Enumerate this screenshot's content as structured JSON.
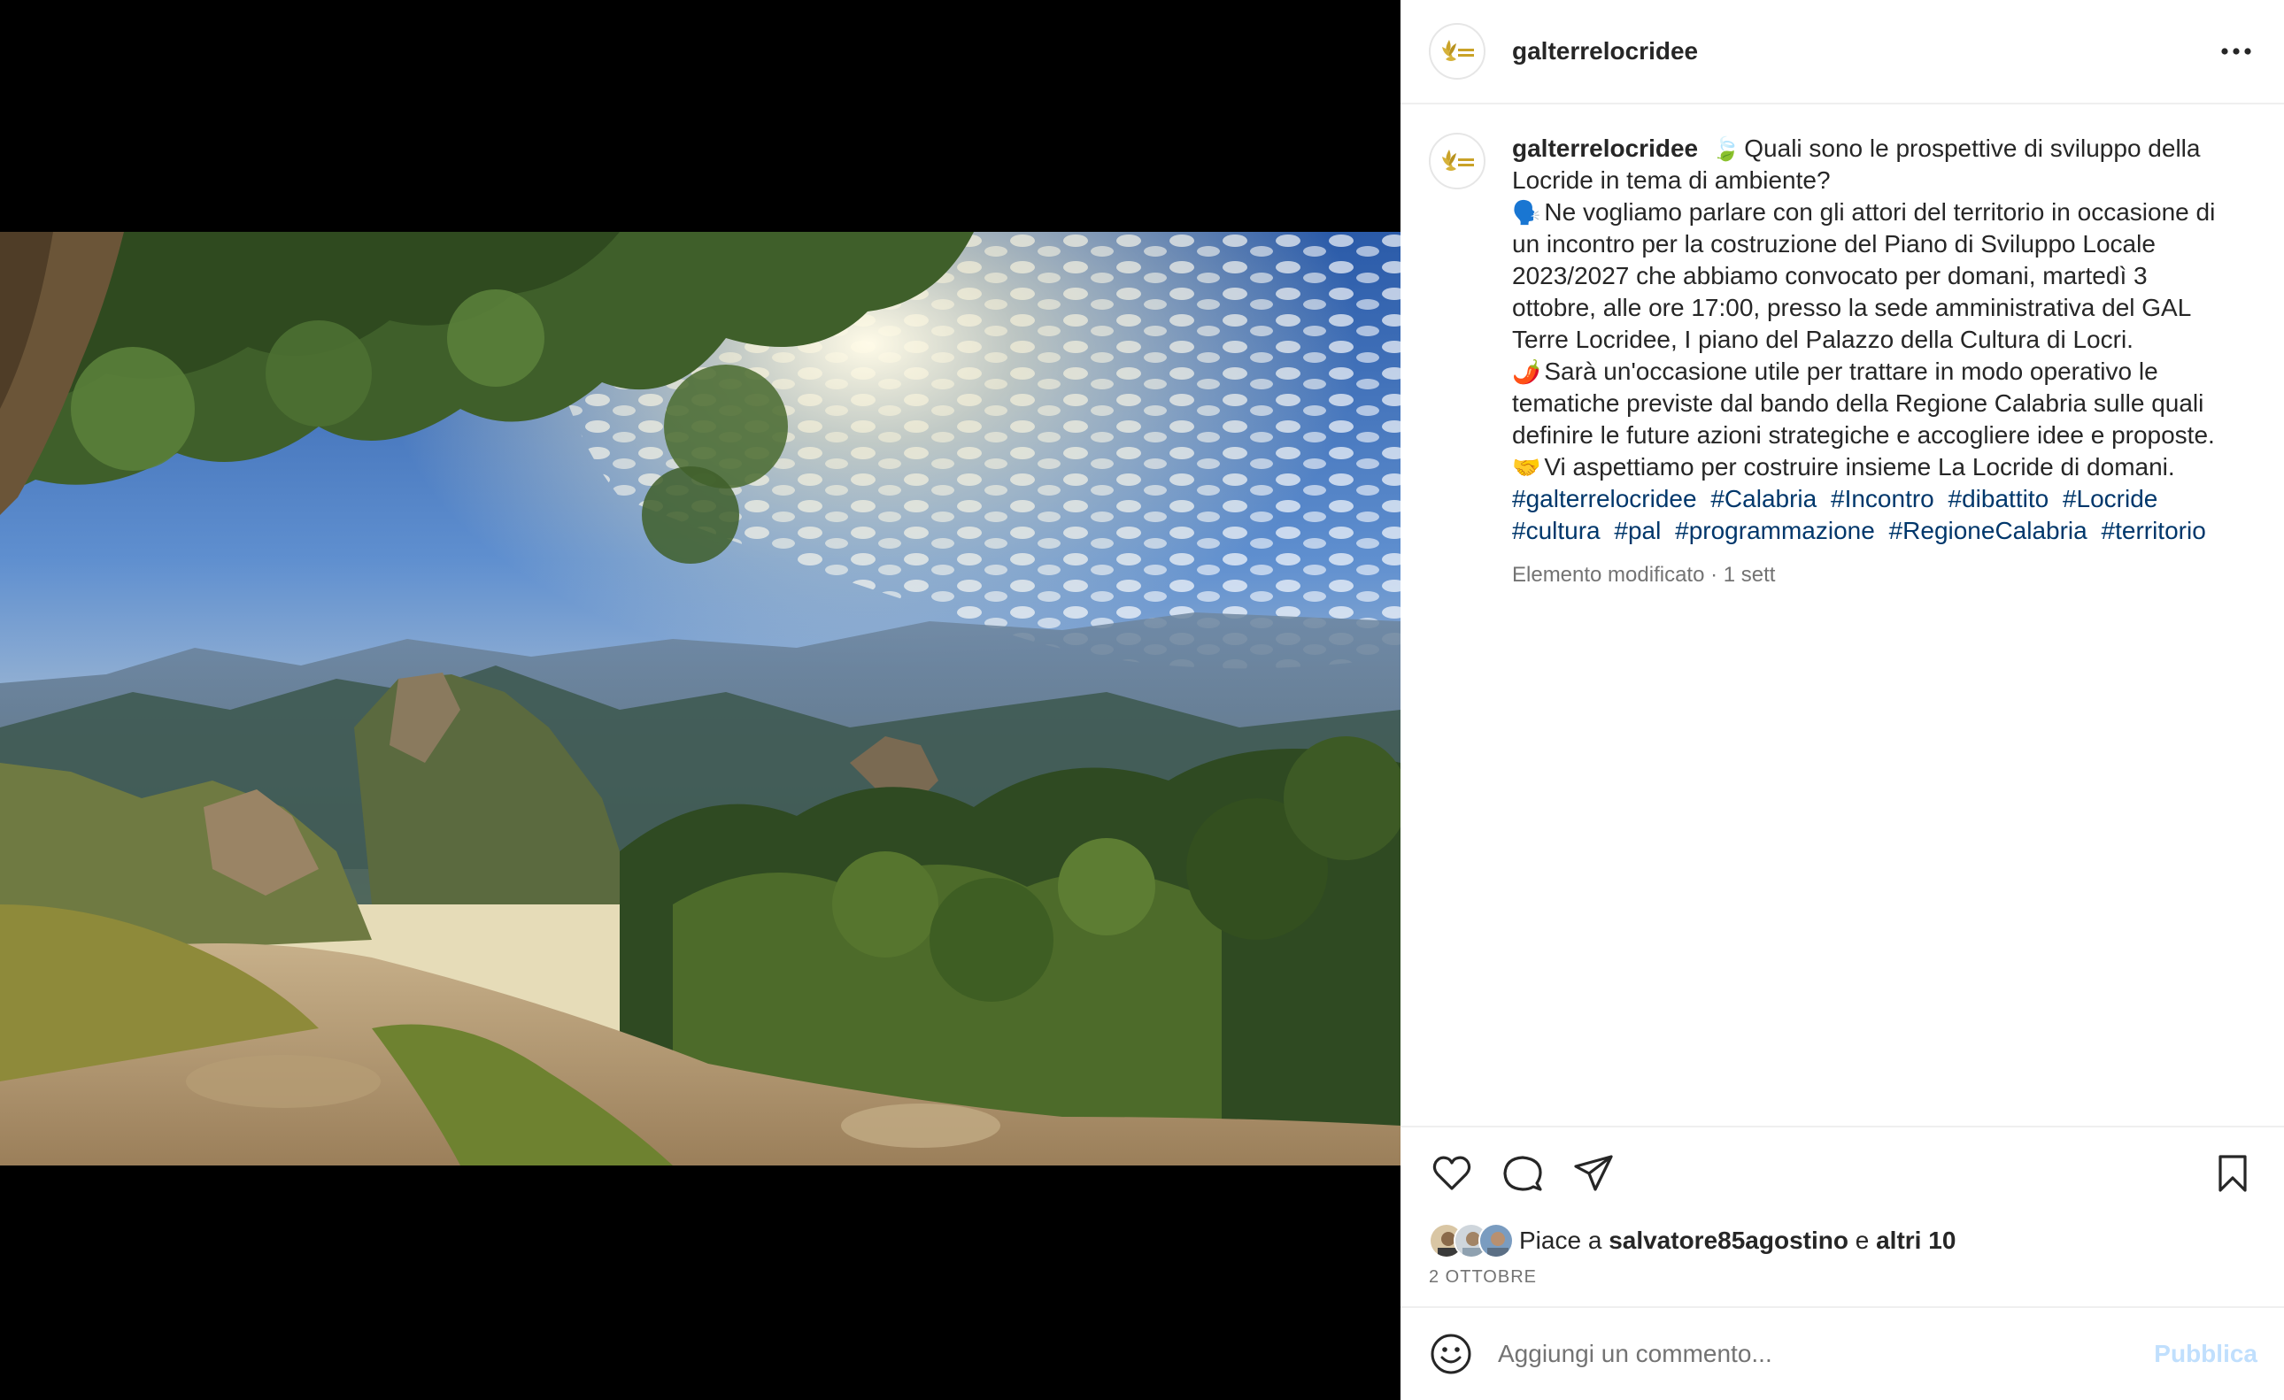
{
  "post": {
    "username": "galterrelocridee",
    "caption": {
      "username": "galterrelocridee",
      "lines": [
        {
          "emoji": "🍃",
          "text": "Quali sono le prospettive di sviluppo della Locride in tema di ambiente?"
        },
        {
          "emoji": "🗣️",
          "text": "Ne vogliamo parlare con gli attori del territorio in occasione di un incontro per la costruzione del Piano di Sviluppo Locale 2023/2027 che abbiamo convocato per domani, martedì 3 ottobre, alle ore 17:00, presso la sede amministrativa del GAL Terre Locridee, I piano del Palazzo della Cultura di Locri."
        },
        {
          "emoji": "🌶️",
          "text": "Sarà un'occasione utile per trattare in modo operativo le tematiche previste dal bando della Regione Calabria sulle quali definire le future azioni strategiche e accogliere idee e proposte."
        },
        {
          "emoji": "🤝",
          "text": "Vi aspettiamo per costruire insieme La Locride di domani."
        }
      ],
      "hashtags": [
        "#galterrelocridee",
        "#Calabria",
        "#Incontro",
        "#dibattito",
        "#Locride",
        "#cultura",
        "#pal",
        "#programmazione",
        "#RegioneCalabria",
        "#territorio"
      ],
      "meta": "Elemento modificato · 1 sett"
    },
    "likes": {
      "prefix": "Piace a",
      "user": "salvatore85agostino",
      "connector": "e",
      "others": "altri 10"
    },
    "date": "2 OTTOBRE",
    "comment_input": {
      "placeholder": "Aggiungi un commento...",
      "publish_label": "Pubblica"
    }
  },
  "icons": {
    "more": "more-horizontal-icon",
    "like": "heart-icon",
    "comment": "comment-bubble-icon",
    "share": "send-icon",
    "save": "bookmark-icon",
    "emoji": "smiley-icon"
  },
  "colors": {
    "hashtag": "#00376b",
    "publish_disabled": "#c0dffd",
    "muted": "#737373",
    "text": "#262626"
  }
}
